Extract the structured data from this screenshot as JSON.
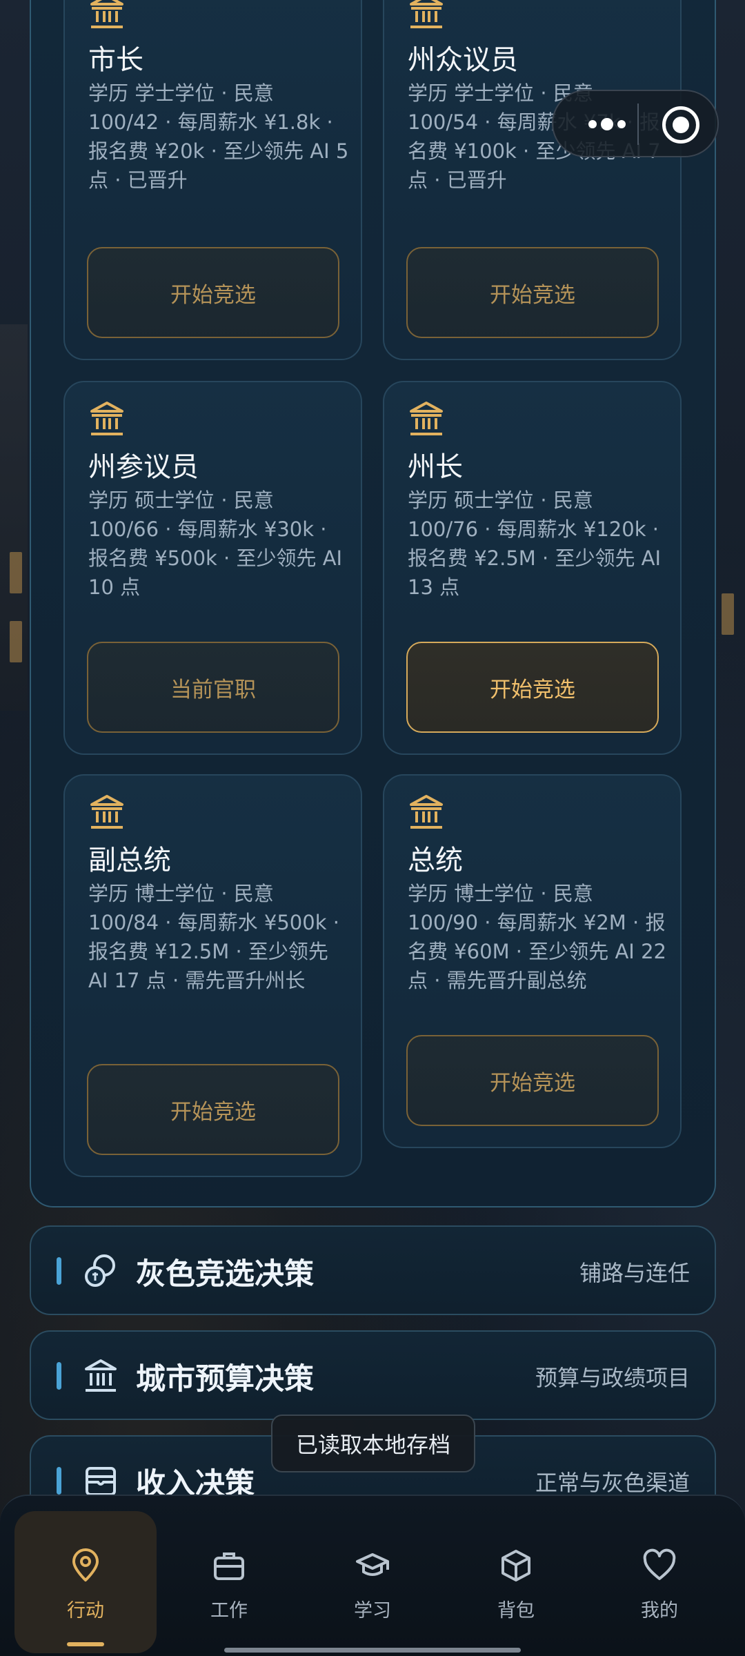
{
  "cards": [
    {
      "title": "市长",
      "desc": "学历 学士学位 · 民意 100/42 · 每周薪水 ¥1.8k · 报名费 ¥20k · 至少领先 AI 5 点 · 已晋升",
      "button": "开始竞选",
      "button_active": false
    },
    {
      "title": "州众议员",
      "desc": "学历 学士学位 · 民意 100/54 · 每周薪水 ¥7k · 报名费 ¥100k · 至少领先 AI 7 点 · 已晋升",
      "button": "开始竞选",
      "button_active": false
    },
    {
      "title": "州参议员",
      "desc": "学历 硕士学位 · 民意 100/66 · 每周薪水 ¥30k · 报名费 ¥500k · 至少领先 AI 10 点",
      "button": "当前官职",
      "button_active": false
    },
    {
      "title": "州长",
      "desc": "学历 硕士学位 · 民意 100/76 · 每周薪水 ¥120k · 报名费 ¥2.5M · 至少领先 AI 13 点",
      "button": "开始竞选",
      "button_active": true
    },
    {
      "title": "副总统",
      "desc": "学历 博士学位 · 民意 100/84 · 每周薪水 ¥500k · 报名费 ¥12.5M · 至少领先 AI 17 点 · 需先晋升州长",
      "button": "开始竞选",
      "button_active": false
    },
    {
      "title": "总统",
      "desc": "学历 博士学位 · 民意 100/90 · 每周薪水 ¥2M · 报名费 ¥60M · 至少领先 AI 22 点 · 需先晋升副总统",
      "button": "开始竞选",
      "button_active": false
    }
  ],
  "sections": [
    {
      "title": "灰色竞选决策",
      "subtitle": "铺路与连任",
      "icon": "coins-icon"
    },
    {
      "title": "城市预算决策",
      "subtitle": "预算与政绩项目",
      "icon": "bank-icon"
    },
    {
      "title": "收入决策",
      "subtitle": "正常与灰色渠道",
      "icon": "wallet-icon"
    }
  ],
  "toast": "已读取本地存档",
  "nav": [
    {
      "label": "行动",
      "icon": "location-pin-icon",
      "active": true
    },
    {
      "label": "工作",
      "icon": "briefcase-icon",
      "active": false
    },
    {
      "label": "学习",
      "icon": "graduation-cap-icon",
      "active": false
    },
    {
      "label": "背包",
      "icon": "cube-icon",
      "active": false
    },
    {
      "label": "我的",
      "icon": "heart-icon",
      "active": false
    }
  ],
  "colors": {
    "accent_gold": "#e2b25f",
    "accent_blue": "#4aa3d6",
    "panel_border": "#2f5a72"
  }
}
